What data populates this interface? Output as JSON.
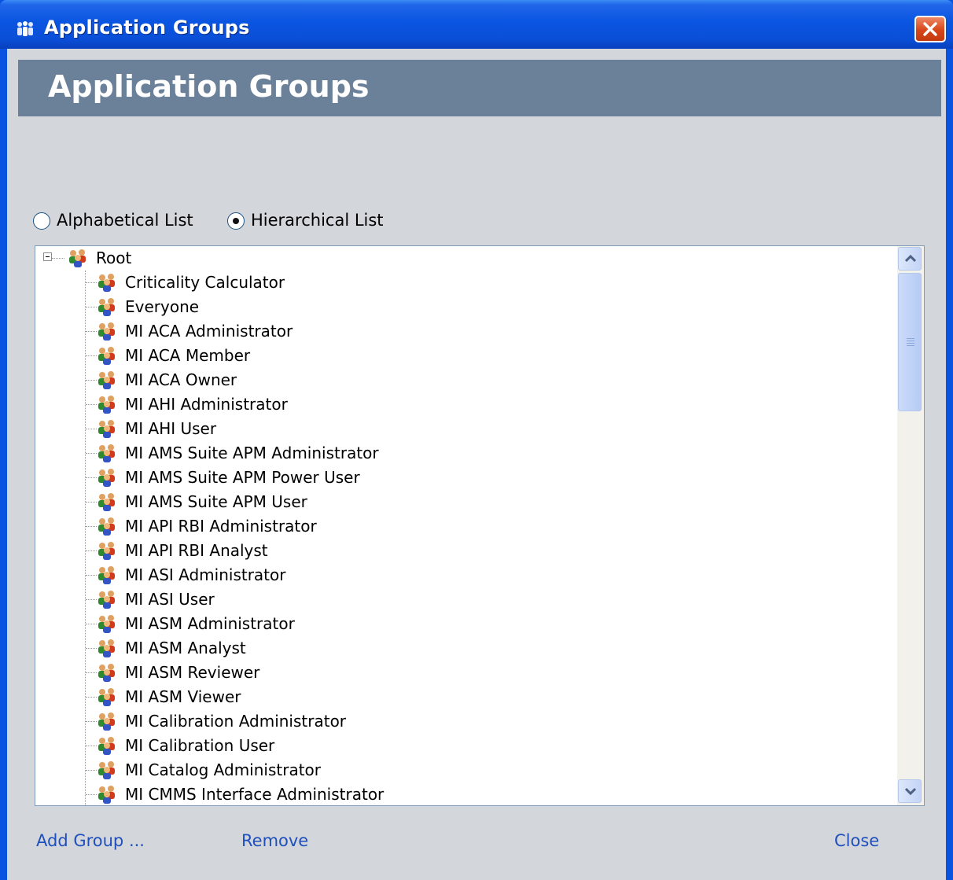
{
  "window": {
    "title": "Application Groups"
  },
  "header": {
    "title": "Application Groups"
  },
  "view_options": {
    "alphabetical_label": "Alphabetical List",
    "hierarchical_label": "Hierarchical List",
    "selected": "Hierarchical List"
  },
  "tree": {
    "root_label": "Root",
    "root_expanded": true,
    "children": [
      "Criticality Calculator",
      "Everyone",
      "MI ACA Administrator",
      "MI ACA Member",
      "MI ACA Owner",
      "MI AHI Administrator",
      "MI AHI User",
      "MI AMS Suite APM Administrator",
      "MI AMS Suite APM Power User",
      "MI AMS Suite APM User",
      "MI API RBI Administrator",
      "MI API RBI Analyst",
      "MI ASI Administrator",
      "MI ASI User",
      "MI ASM Administrator",
      "MI ASM Analyst",
      "MI ASM Reviewer",
      "MI ASM Viewer",
      "MI Calibration Administrator",
      "MI Calibration User",
      "MI Catalog Administrator",
      "MI CMMS Interface Administrator"
    ]
  },
  "footer": {
    "add_group": "Add Group ...",
    "remove": "Remove",
    "close": "Close"
  },
  "icons": {
    "title": "app-group-icon",
    "close": "close-x-icon",
    "group": "user-group-icon",
    "scroll_up": "chevron-up-icon",
    "scroll_down": "chevron-down-icon"
  },
  "colors": {
    "title_bar": "#0a55e1",
    "banner": "#6a8199",
    "client_bg": "#d3d7db",
    "link": "#1f4fbd",
    "close_button": "#d74618"
  }
}
